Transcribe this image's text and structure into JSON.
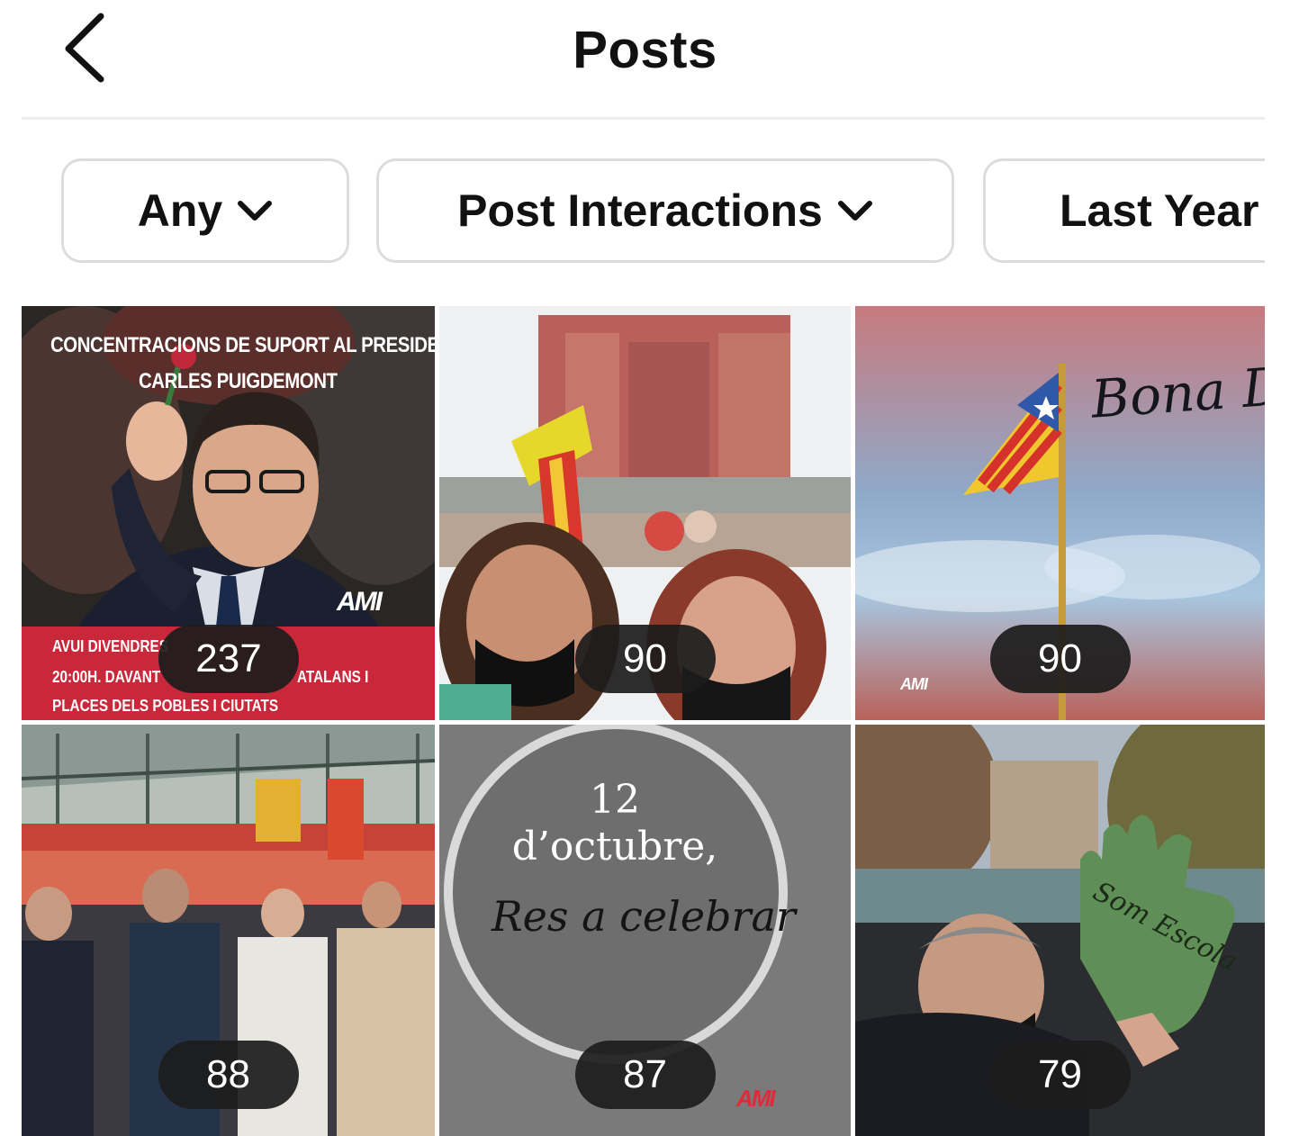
{
  "header": {
    "title": "Posts"
  },
  "filters": [
    {
      "label": "Any"
    },
    {
      "label": "Post Interactions"
    },
    {
      "label": "Last Year"
    }
  ],
  "posts": [
    {
      "count": "237",
      "headline_1": "CONCENTRACIONS DE SUPORT AL PRESIDENT",
      "headline_2": "CARLES PUIGDEMONT",
      "banner_1": "AVUI DIVENDRES",
      "banner_2": "20:00H. DAVANT",
      "banner_2b": "ATALANS I",
      "banner_3": "PLACES DELS POBLES I CIUTATS",
      "logo": "AMI"
    },
    {
      "count": "90"
    },
    {
      "count": "90",
      "script_text": "Bona Diada",
      "logo": "AMI"
    },
    {
      "count": "88"
    },
    {
      "count": "87",
      "date_line_1": "12",
      "date_line_2": "d’octubre,",
      "script_text": "Res a celebrar",
      "logo": "AMI"
    },
    {
      "count": "79",
      "glove_text": "Som Escola"
    }
  ],
  "colors": {
    "text": "#111111",
    "chip_border": "#dcdcdc",
    "badge_bg": "#1c1c1c",
    "banner_red": "#c8283a"
  }
}
